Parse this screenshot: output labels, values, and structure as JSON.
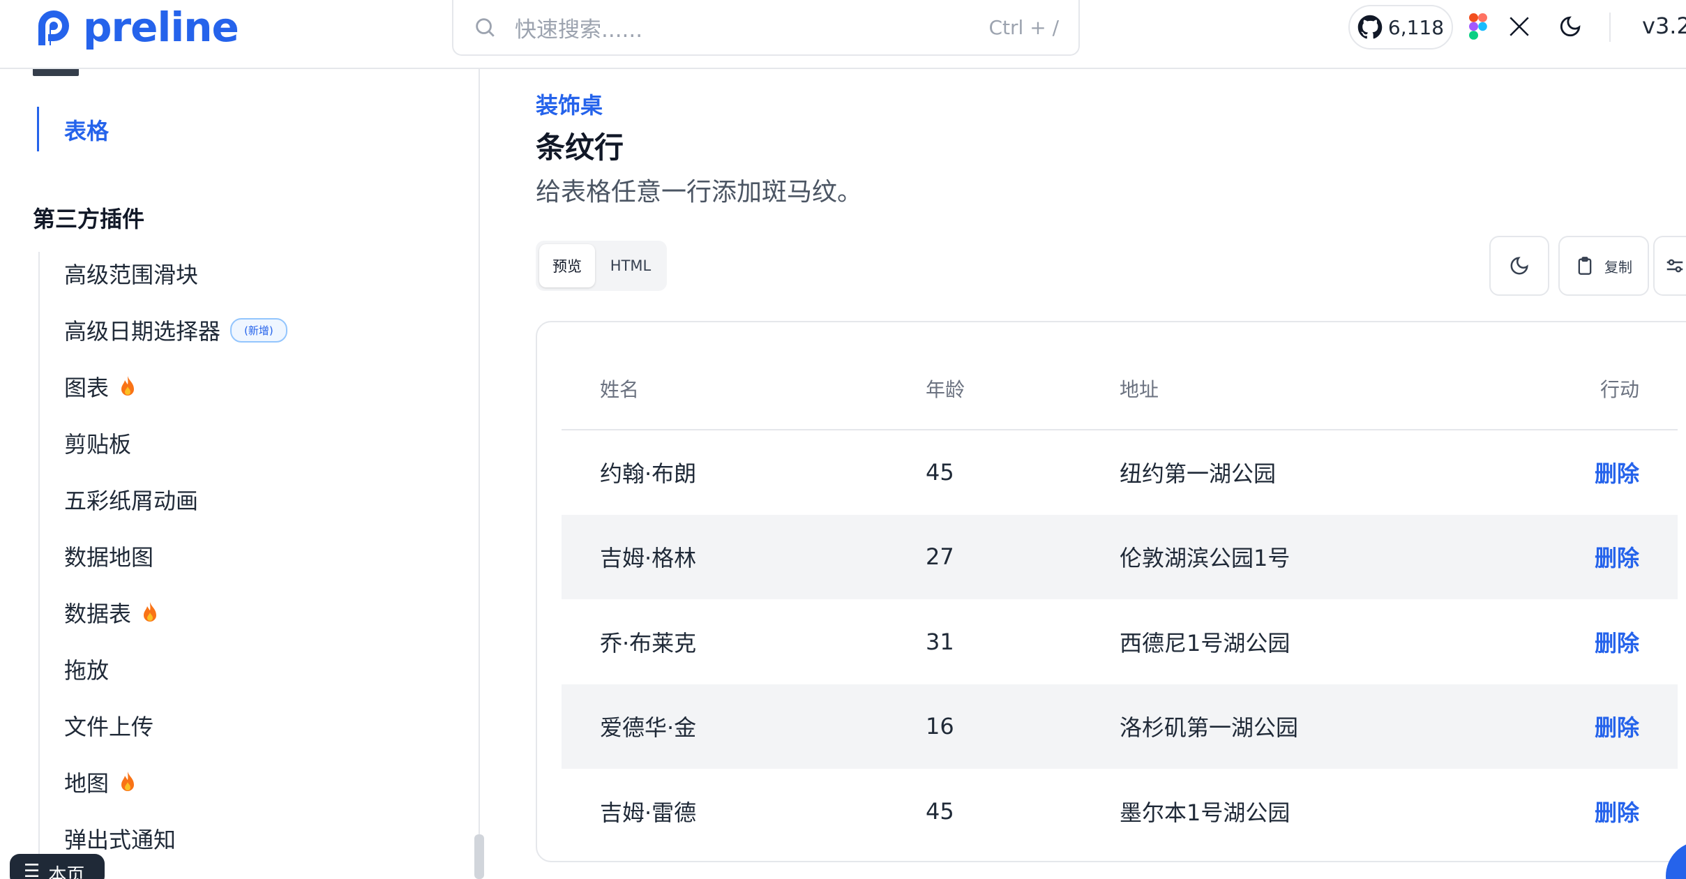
{
  "header": {
    "logo_text": "preline",
    "search_placeholder": "快速搜索......",
    "search_shortcut": "Ctrl + /",
    "github_stars": "6,118",
    "version": "v3.2"
  },
  "sidebar": {
    "active_item": "表格",
    "section_heading": "第三方插件",
    "items": [
      {
        "label": "高级范围滑块"
      },
      {
        "label": "高级日期选择器",
        "badge": "(新增)"
      },
      {
        "label": "图表",
        "hot": true
      },
      {
        "label": "剪贴板"
      },
      {
        "label": "五彩纸屑动画"
      },
      {
        "label": "数据地图"
      },
      {
        "label": "数据表",
        "hot": true
      },
      {
        "label": "拖放"
      },
      {
        "label": "文件上传"
      },
      {
        "label": "地图",
        "hot": true
      },
      {
        "label": "弹出式通知"
      }
    ],
    "this_page_label": "本页"
  },
  "main": {
    "kicker": "装饰桌",
    "title": "条纹行",
    "description": "给表格任意一行添加斑马纹。",
    "tabs": [
      "预览",
      "HTML"
    ],
    "copy_label": "复制"
  },
  "table": {
    "columns": [
      "姓名",
      "年龄",
      "地址",
      "行动"
    ],
    "rows": [
      {
        "name": "约翰·布朗",
        "age": "45",
        "address": "纽约第一湖公园",
        "action": "删除"
      },
      {
        "name": "吉姆·格林",
        "age": "27",
        "address": "伦敦湖滨公园1号",
        "action": "删除"
      },
      {
        "name": "乔·布莱克",
        "age": "31",
        "address": "西德尼1号湖公园",
        "action": "删除"
      },
      {
        "name": "爱德华·金",
        "age": "16",
        "address": "洛杉矶第一湖公园",
        "action": "删除"
      },
      {
        "name": "吉姆·雷德",
        "age": "45",
        "address": "墨尔本1号湖公园",
        "action": "删除"
      }
    ]
  },
  "colors": {
    "accent": "#2563eb",
    "stripe": "#f3f4f6",
    "border": "#e5e7eb"
  }
}
